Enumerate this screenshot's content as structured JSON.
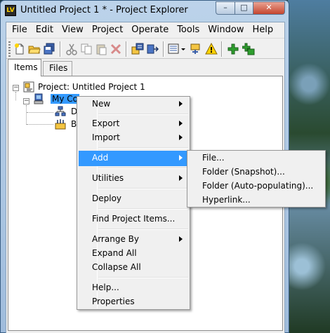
{
  "window": {
    "title": "Untitled Project 1 * - Project Explorer",
    "app_icon_text": "LV"
  },
  "menubar": [
    "File",
    "Edit",
    "View",
    "Project",
    "Operate",
    "Tools",
    "Window",
    "Help"
  ],
  "toolbar": {
    "icons": [
      "new-icon",
      "open-icon",
      "save-all-icon",
      "cut-icon",
      "copy-icon",
      "paste-icon",
      "delete-icon",
      "build-icon",
      "deploy-icon",
      "view-options-icon",
      "project-settings-icon",
      "warning-icon",
      "add-icon",
      "add-file-icon"
    ]
  },
  "tabs": {
    "items": "Items",
    "files": "Files"
  },
  "tree": {
    "project": "Project: Untitled Project 1",
    "computer": "My Computer",
    "dependencies": "Dependencies",
    "build_specs": "Build Specifications",
    "computer_visible": "My Co",
    "dependencies_visible": "De",
    "build_visible": "Bui"
  },
  "context_menu": {
    "items": [
      "New",
      "Export",
      "Import",
      "Add",
      "Utilities",
      "Deploy",
      "Find Project Items...",
      "Arrange By",
      "Expand All",
      "Collapse All",
      "Help...",
      "Properties"
    ],
    "highlighted": "Add"
  },
  "submenu": {
    "items": [
      "File...",
      "Folder (Snapshot)...",
      "Folder (Auto-populating)...",
      "Hyperlink..."
    ]
  },
  "colors": {
    "selection": "#3399ff",
    "menu_bg": "#f0f0f0",
    "title_gradient_top": "#bcd3ea"
  }
}
